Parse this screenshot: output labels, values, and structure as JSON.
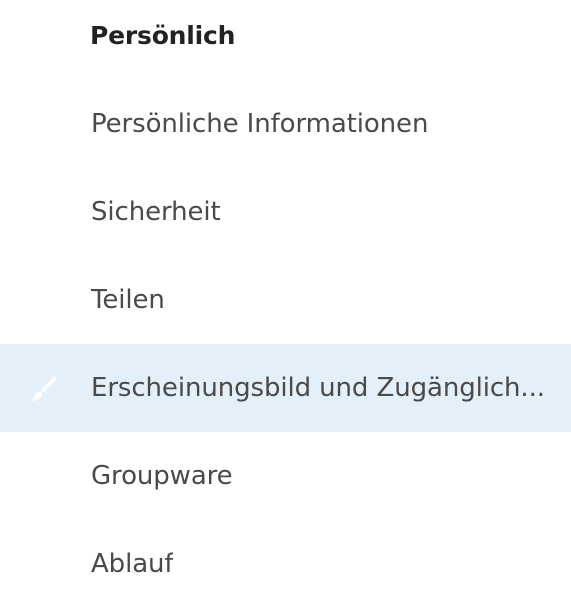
{
  "section": {
    "title": "Persönlich"
  },
  "items": [
    {
      "label": "Persönliche Informationen",
      "active": false
    },
    {
      "label": "Sicherheit",
      "active": false
    },
    {
      "label": "Teilen",
      "active": false
    },
    {
      "label": "Erscheinungsbild und Zugänglich...",
      "active": true,
      "icon": "brush-icon"
    },
    {
      "label": "Groupware",
      "active": false
    },
    {
      "label": "Ablauf",
      "active": false
    }
  ],
  "colors": {
    "active_background": "#e3f0f9",
    "text": "#4a4a4a",
    "title": "#222222"
  }
}
